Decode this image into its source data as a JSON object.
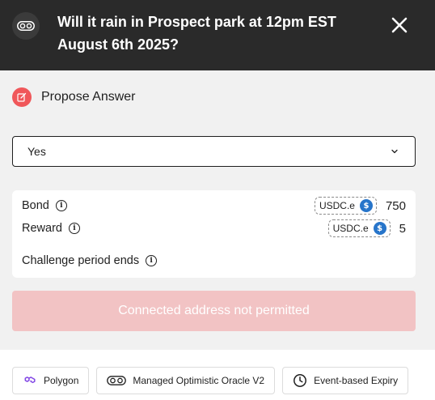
{
  "header": {
    "title": "Will it rain in Prospect park at 12pm EST August 6th 2025?",
    "badge_icon": "oracle-eyes-icon",
    "close_icon": "close-icon"
  },
  "propose": {
    "label": "Propose Answer",
    "icon": "edit-icon"
  },
  "answer_select": {
    "value": "Yes",
    "icon": "chevron-down-icon"
  },
  "details": {
    "bond": {
      "label": "Bond",
      "token": "USDC.e",
      "amount": "750"
    },
    "reward": {
      "label": "Reward",
      "token": "USDC.e",
      "amount": "5"
    },
    "challenge": {
      "label": "Challenge period ends"
    },
    "info_glyph": "i"
  },
  "submit": {
    "label": "Connected address not permitted",
    "disabled": true
  },
  "chips": [
    {
      "label": "Polygon",
      "icon": "polygon-icon"
    },
    {
      "label": "Managed Optimistic Oracle V2",
      "icon": "oracle-eyes-icon"
    },
    {
      "label": "Event-based Expiry",
      "icon": "clock-icon"
    }
  ],
  "colors": {
    "header_bg": "#2a2a2a",
    "panel_bg": "#f1f1f1",
    "accent_red": "#f0575a",
    "disabled_button": "#f2c3c4",
    "usdc_blue": "#2775ca",
    "polygon_purple": "#8247e5"
  }
}
